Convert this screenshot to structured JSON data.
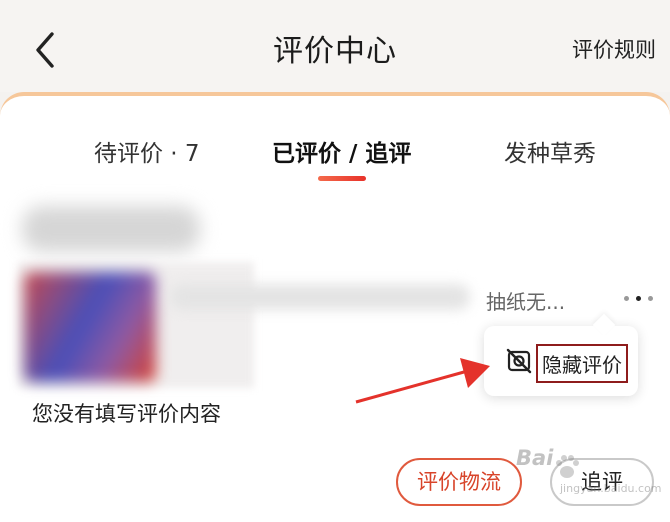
{
  "header": {
    "title": "评价中心",
    "rules_label": "评价规则",
    "back_icon": "chevron-left-icon"
  },
  "tabs": [
    {
      "label": "待评价 · 7",
      "active": false
    },
    {
      "label": "已评价 / 追评",
      "active": true
    },
    {
      "label": "发种草秀",
      "active": false
    }
  ],
  "review_item": {
    "product_name": "抽纸无...",
    "empty_text": "您没有填写评价内容",
    "more_icon": "more-dots-icon"
  },
  "popup_menu": {
    "hide_label": "隐藏评价",
    "hide_icon": "hide-eye-slash-icon"
  },
  "actions": {
    "logistics_label": "评价物流",
    "followup_label": "追评"
  },
  "watermark": {
    "text": "Bai",
    "sub": "jingyan.baidu.com"
  },
  "colors": {
    "accent": "#e8322a",
    "highlight_box": "#8e1c1c",
    "tab_border": "#f6c79a"
  }
}
